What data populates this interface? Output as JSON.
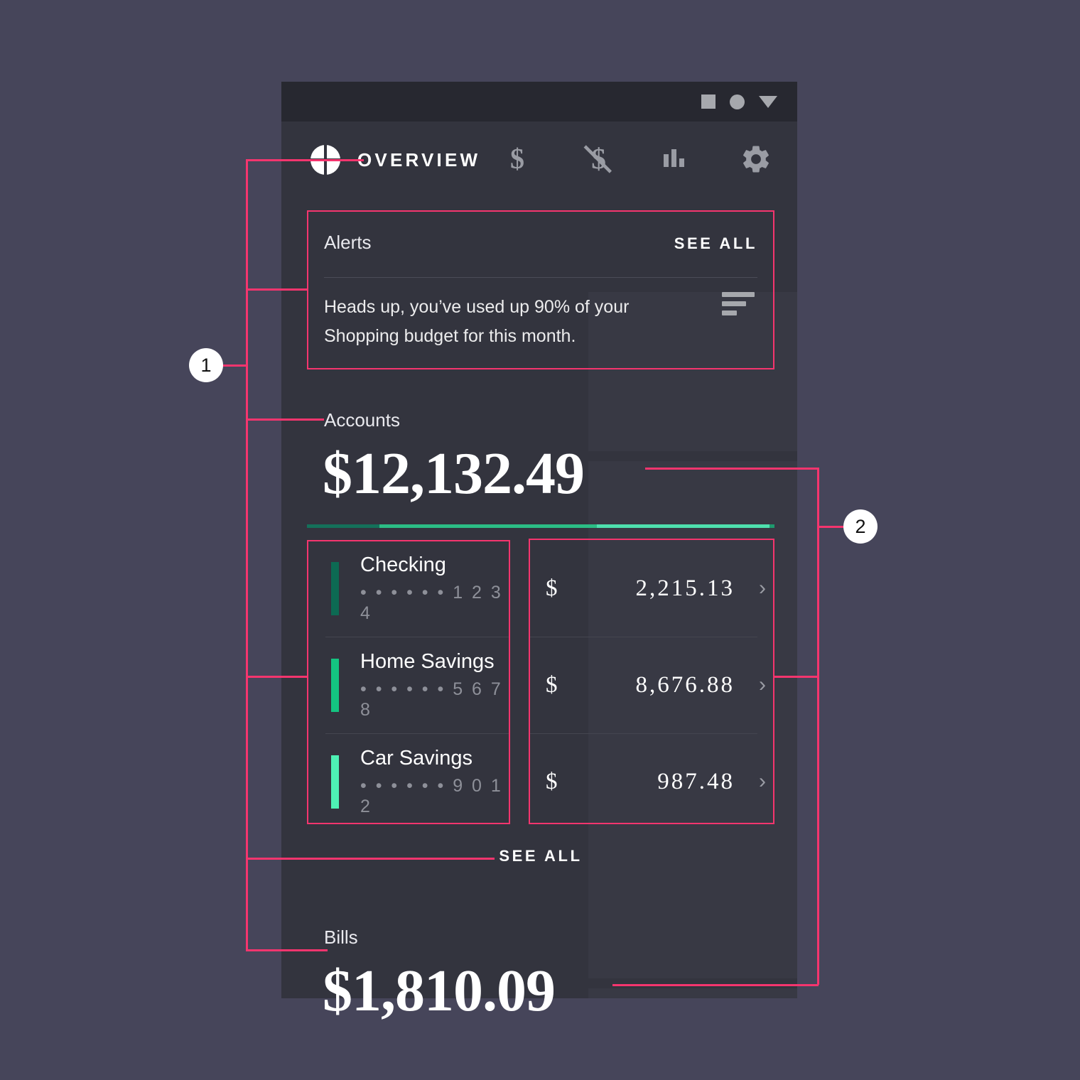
{
  "window": {
    "controls": [
      {
        "name": "stop-square",
        "shape": "square"
      },
      {
        "name": "record-circle",
        "shape": "circle"
      },
      {
        "name": "dropdown-triangle",
        "shape": "triangle"
      }
    ]
  },
  "nav": {
    "logo": "logo-mark",
    "title": "OVERVIEW",
    "icons": [
      {
        "name": "dollar-icon",
        "label": "$"
      },
      {
        "name": "money-off-icon",
        "label": "$/"
      },
      {
        "name": "bar-chart-icon",
        "label": "chart"
      },
      {
        "name": "gear-icon",
        "label": "settings"
      }
    ]
  },
  "alerts": {
    "title": "Alerts",
    "see_all": "SEE ALL",
    "message": "Heads up, you’ve used up 90% of your Shopping budget for this month.",
    "sort_icon": "sort-icon"
  },
  "accounts": {
    "title": "Accounts",
    "total": "$12,132.49",
    "see_all": "SEE ALL",
    "bar_segments": [
      {
        "color": "#14705a",
        "width": 15.5
      },
      {
        "color": "#2bbd85",
        "width": 46.5
      },
      {
        "color": "#4ee0ae",
        "width": 37.0
      },
      {
        "color": "#1e9a6e",
        "width": 1.0
      }
    ],
    "rows": [
      {
        "name": "Checking",
        "masked": "• • • • • • 1 2 3 4",
        "color": "#0d6a53",
        "currency": "$",
        "amount": "2,215.13",
        "chevron": "›"
      },
      {
        "name": "Home Savings",
        "masked": "• • • • • • 5 6 7 8",
        "color": "#14c481",
        "currency": "$",
        "amount": "8,676.88",
        "chevron": "›"
      },
      {
        "name": "Car Savings",
        "masked": "• • • • • • 9 0 1 2",
        "color": "#4ef0b4",
        "currency": "$",
        "amount": "987.48",
        "chevron": "›"
      }
    ]
  },
  "bills": {
    "title": "Bills",
    "total": "$1,810.09"
  },
  "annotations": {
    "accent_color": "#f5356e",
    "markers": [
      {
        "label": "1"
      },
      {
        "label": "2"
      }
    ]
  }
}
